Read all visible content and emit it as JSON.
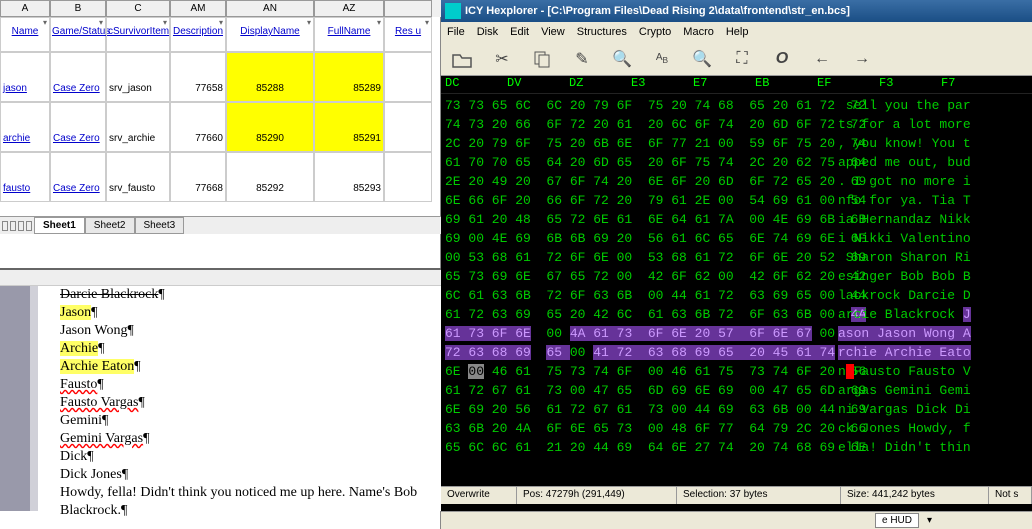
{
  "spread": {
    "cols": [
      "A",
      "B",
      "C",
      "AM",
      "AN",
      "AZ"
    ],
    "last_col": "",
    "headers": [
      "Name",
      "Game/Status",
      "cSurvivorItem",
      "Description",
      "DisplayName",
      "FullName",
      "Res u"
    ],
    "rows": [
      {
        "a": "jason",
        "b": "Case Zero",
        "c": "srv_jason",
        "am": "77658",
        "an": "85288",
        "az": "85289"
      },
      {
        "a": "archie",
        "b": "Case Zero",
        "c": "srv_archie",
        "am": "77660",
        "an": "85290",
        "az": "85291"
      },
      {
        "a": "fausto",
        "b": "Case Zero",
        "c": "srv_fausto",
        "am": "77668",
        "an": "85292",
        "az": "85293"
      }
    ],
    "tabs": [
      "Sheet1",
      "Sheet2",
      "Sheet3"
    ]
  },
  "word": {
    "lines": [
      {
        "t": "Darcie Blackrock",
        "strike": true
      },
      {
        "t": "Jason",
        "hl": true
      },
      {
        "t": "Jason Wong",
        "hl": false
      },
      {
        "t": "Archie",
        "hl": true
      },
      {
        "t": "Archie Eaton",
        "hl": true
      },
      {
        "t": "Fausto",
        "sq": true
      },
      {
        "t": "Fausto Vargas",
        "sq": true
      },
      {
        "t": "Gemini"
      },
      {
        "t": "Gemini Vargas",
        "sq": true
      },
      {
        "t": "Dick"
      },
      {
        "t": "Dick Jones"
      },
      {
        "t": "Howdy, fella! Didn't think you noticed me up here. Name's Bob Blackrock."
      }
    ]
  },
  "hex": {
    "title": "ICY Hexplorer - [C:\\Program Files\\Dead Rising 2\\data\\frontend\\str_en.bcs]",
    "menus": [
      "File",
      "Disk",
      "Edit",
      "View",
      "Structures",
      "Crypto",
      "Macro",
      "Help"
    ],
    "col_headers": [
      "DC",
      "DV",
      "DZ",
      "E3",
      "E7",
      "EB",
      "EF",
      "F3",
      "F7"
    ],
    "rows_hex": [
      {
        "l": "73 73 65 6C  6C 20 79 6F  75 20 74 68  65 20 61 72  72",
        "r": " sell you the par"
      },
      {
        "l": "74 73 20 66  6F 72 20 61  20 6C 6F 74  20 6D 6F 72  72",
        "r": "ts for a lot more"
      },
      {
        "l": "2C 20 79 6F  75 20 6B 6E  6F 77 21 00  59 6F 75 20  74",
        "r": ", you know! You t"
      },
      {
        "l": "61 70 70 65  64 20 6D 65  20 6F 75 74  2C 20 62 75  64",
        "r": "apped me out, bud"
      },
      {
        "l": "2E 20 49 20  67 6F 74 20  6E 6F 20 6D  6F 72 65 20  69",
        "r": ". I got no more i"
      },
      {
        "l": "6E 66 6F 20  66 6F 72 20  79 61 2E 00  54 69 61 00  54",
        "r": "nfo for ya. Tia T"
      },
      {
        "l": "69 61 20 48  65 72 6E 61  6E 64 61 7A  00 4E 69 6B  6B",
        "r": "ia Hernandaz Nikk"
      },
      {
        "l": "69 00 4E 69  6B 6B 69 20  56 61 6C 65  6E 74 69 6E  6F",
        "r": "i Nikki Valentino"
      },
      {
        "l": "00 53 68 61  72 6F 6E 00  53 68 61 72  6F 6E 20 52  69",
        "r": " Sharon Sharon Ri"
      },
      {
        "l": "65 73 69 6E  67 65 72 00  42 6F 62 00  42 6F 62 20  42",
        "r": "esinger Bob Bob B"
      },
      {
        "l": "6C 61 63 6B  72 6F 63 6B  00 44 61 72  63 69 65 00  44",
        "r": "lackrock Darcie D"
      },
      {
        "l": "61 72 63 69  65 20 42 6C  61 63 6B 72  6F 63 6B 00  ",
        "r": "arcie Blackrock ",
        "sel_suffix": "4A",
        "sel_r": "J"
      },
      {
        "l_sel": "61 73 6F 6E",
        "l_mid": "  00 ",
        "l_sel2": "4A 61 73  6F 6E 20 57  6F 6E 67",
        "l_end": " 00  41",
        "r_sel": "ason Jason Wong A"
      },
      {
        "l_sel": "72 63 68 69",
        "l_mid": "  ",
        "l_sel2": "65 ",
        "l_plain": "00 ",
        "l_sel3": "41 72  63 68 69 65  20 45 61 74",
        "l_end": "  6F",
        "r_sel": "rchie Archie Eato"
      },
      {
        "l_plain": "6E ",
        "l_gray": "00",
        "l_rest": " 46 61  75 73 74 6F  00 46 61 75  73 74 6F 20  56",
        "r_plain": "n",
        "r_cur": " ",
        "r_rest": "Fausto Fausto V"
      },
      {
        "l": "61 72 67 61  73 00 47 65  6D 69 6E 69  00 47 65 6D  69",
        "r": "argas Gemini Gemi"
      },
      {
        "l": "6E 69 20 56  61 72 67 61  73 00 44 69  63 6B 00 44  69",
        "r": "ni Vargas Dick Di"
      },
      {
        "l": "63 6B 20 4A  6F 6E 65 73  00 48 6F 77  64 79 2C 20  66",
        "r": "ck Jones Howdy, f"
      },
      {
        "l": "65 6C 6C 61  21 20 44 69  64 6E 27 74  20 74 68 69  6E",
        "r": "ella! Didn't thin"
      }
    ],
    "status": {
      "mode": "Overwrite",
      "pos": "Pos: 47279h (291,449)",
      "sel": "Selection: 37 bytes",
      "size": "Size: 441,242 bytes",
      "nots": "Not s"
    }
  },
  "bottom": {
    "dropdown": "e HUD"
  }
}
